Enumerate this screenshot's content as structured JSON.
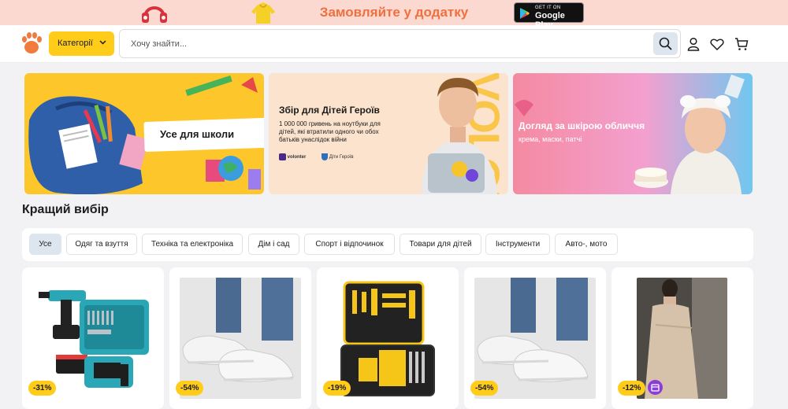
{
  "promo": {
    "text": "Замовляйте у додатку",
    "store_small": "GET IT ON",
    "store_big": "Google Play"
  },
  "header": {
    "categories_label": "Категорії",
    "search_placeholder": "Хочу знайти..."
  },
  "banners": [
    {
      "title": "Усе для школи"
    },
    {
      "title": "Збір для Дітей Героїв",
      "description": "1 000 000 гривень на ноутбуки для дітей, які втратили одного чи обох батьків унаслідок війни",
      "side_word": "VOLONTER",
      "logo1": "volonter",
      "logo2": "Діти Героїв"
    },
    {
      "title": "Догляд за шкірою обличчя",
      "subtitle": "крема, маски, патчі"
    }
  ],
  "section": {
    "title": "Кращий вибір",
    "tabs": [
      "Усе",
      "Одяг та взуття",
      "Техніка та електроніка",
      "Дім і сад",
      "Спорт і відпочинок",
      "Товари для дітей",
      "Інструменти",
      "Авто-, мото"
    ],
    "active_tab": "Усе"
  },
  "products": [
    {
      "discount": "-31%",
      "image": "cordless-drill-kit"
    },
    {
      "discount": "-54%",
      "image": "white-sneakers"
    },
    {
      "discount": "-19%",
      "image": "tool-case-yellow"
    },
    {
      "discount": "-54%",
      "image": "white-sneakers"
    },
    {
      "discount": "-12%",
      "image": "beige-dress",
      "extra_badge": "purple-gift-icon"
    }
  ],
  "colors": {
    "accent": "#ffcc1a",
    "promo_bg": "#fbd9d0",
    "promo_text": "#f06f3d",
    "active_tab": "#dde6ef"
  }
}
